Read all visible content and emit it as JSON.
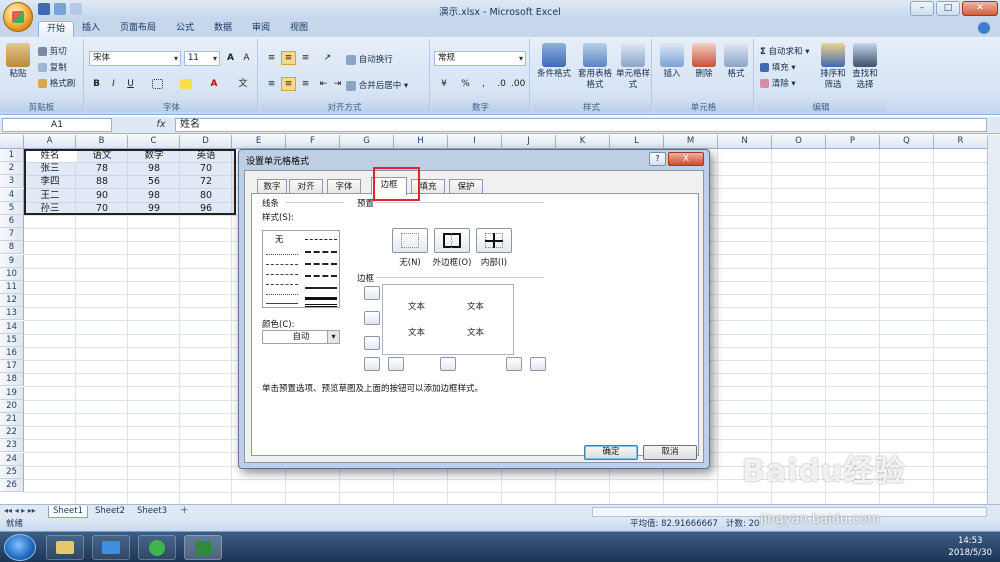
{
  "window": {
    "title": "演示.xlsx - Microsoft Excel"
  },
  "ribbon_tabs": [
    "开始",
    "插入",
    "页面布局",
    "公式",
    "数据",
    "审阅",
    "视图"
  ],
  "ribbon": {
    "clipboard": {
      "group": "剪贴板",
      "paste": "粘贴",
      "cut": "剪切",
      "copy": "复制",
      "format_painter": "格式刷"
    },
    "font": {
      "group": "字体",
      "font_name": "宋体",
      "font_size": "11",
      "bold": "B",
      "italic": "I",
      "underline": "U"
    },
    "alignment": {
      "group": "对齐方式",
      "wrap": "自动换行",
      "merge": "合并后居中"
    },
    "number": {
      "group": "数字",
      "format": "常规",
      "percent": "%"
    },
    "styles": {
      "group": "样式",
      "cond": "条件格式",
      "table": "套用表格格式",
      "cell": "单元格样式"
    },
    "cells": {
      "group": "单元格",
      "insert": "插入",
      "delete": "删除",
      "format": "格式"
    },
    "editing": {
      "group": "编辑",
      "autosum": "自动求和",
      "fill": "填充",
      "clear": "清除",
      "sort": "排序和筛选",
      "find": "查找和选择"
    }
  },
  "formula_bar": {
    "name_box": "A1",
    "fx": "fx",
    "content": "姓名"
  },
  "columns": [
    "A",
    "B",
    "C",
    "D",
    "E",
    "F",
    "G",
    "H",
    "I",
    "J",
    "K",
    "L",
    "M",
    "N",
    "O",
    "P",
    "Q",
    "R"
  ],
  "rows": [
    "1",
    "2",
    "3",
    "4",
    "5",
    "6",
    "7",
    "8",
    "9",
    "10",
    "11",
    "12",
    "13",
    "14",
    "15",
    "16",
    "17",
    "18",
    "19",
    "20",
    "21",
    "22",
    "23",
    "24",
    "25",
    "26"
  ],
  "table": [
    [
      "姓名",
      "语文",
      "数学",
      "英语"
    ],
    [
      "张三",
      "78",
      "98",
      "70"
    ],
    [
      "李四",
      "88",
      "56",
      "72"
    ],
    [
      "王二",
      "90",
      "98",
      "80"
    ],
    [
      "孙三",
      "70",
      "99",
      "96"
    ]
  ],
  "sheets": [
    "Sheet1",
    "Sheet2",
    "Sheet3"
  ],
  "status": {
    "mode": "就绪",
    "average": "平均值: 82.91666667",
    "count": "计数: 20"
  },
  "clock": {
    "time": "14:53",
    "date": "2018/5/30"
  },
  "dialog": {
    "title": "设置单元格格式",
    "help": "?",
    "close": "X",
    "tabs": [
      "数字",
      "对齐",
      "字体",
      "边框",
      "填充",
      "保护"
    ],
    "active_tab": "边框",
    "line_section": "线条",
    "style_label": "样式(S):",
    "style_none": "无",
    "color_label": "颜色(C):",
    "color_value": "自动",
    "presets_label": "预置",
    "presets": [
      "无(N)",
      "外边框(O)",
      "内部(I)"
    ],
    "border_label": "边框",
    "preview_text": [
      "文本",
      "文本",
      "文本",
      "文本"
    ],
    "hint": "单击预置选项、预览草图及上面的按钮可以添加边框样式。",
    "ok": "确定",
    "cancel": "取消"
  },
  "watermark": {
    "logo": "Baidu经验",
    "url": "jingyan.baidu.com"
  }
}
